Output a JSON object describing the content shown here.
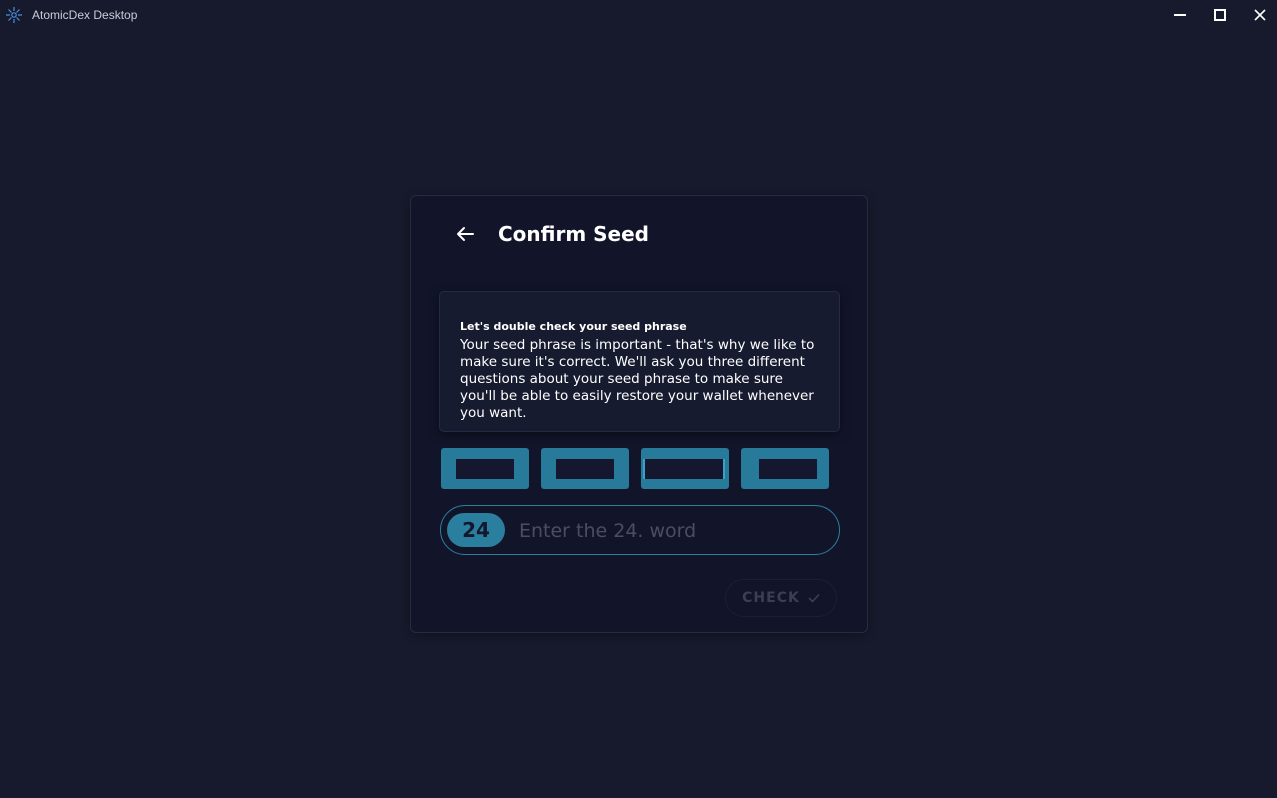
{
  "window": {
    "title": "AtomicDex Desktop",
    "controls": [
      "minimize-icon",
      "maximize-icon",
      "close-icon"
    ]
  },
  "card": {
    "title": "Confirm Seed",
    "back_icon": "arrow-left-icon",
    "info": {
      "heading": "Let's double check your seed phrase",
      "body": "Your seed phrase is important - that's why we like to make sure it's correct. We'll ask you three different questions about your seed phrase to make sure you'll be able to easily restore your wallet whenever you want."
    },
    "word_choices": [
      "",
      "",
      "",
      ""
    ],
    "word_input": {
      "index": "24",
      "value": "",
      "placeholder": "Enter the 24. word"
    },
    "check_button": {
      "label": "CHECK",
      "icon": "checkmark-icon",
      "enabled": false
    }
  },
  "colors": {
    "background": "#161a2c",
    "card": "#12152a",
    "accent": "#287a9a",
    "disabled_text": "#3b3f55"
  }
}
